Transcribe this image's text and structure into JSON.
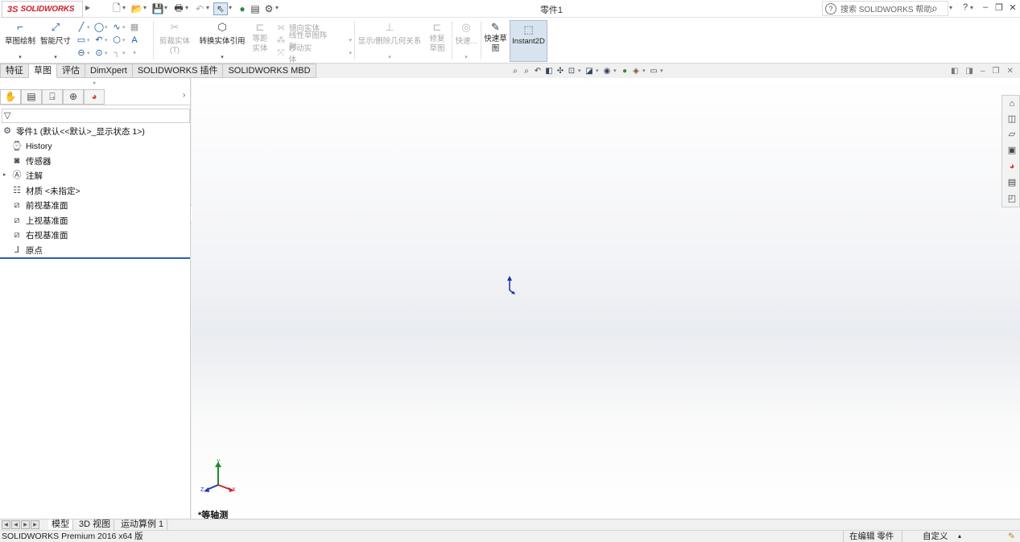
{
  "app": {
    "logo_ds": "3S",
    "logo_text": "SOLIDWORKS",
    "doc_title": "零件1",
    "search_placeholder": "搜索 SOLIDWORKS 帮助",
    "help_label": "?"
  },
  "command_manager": {
    "sketch": "草图绘制",
    "smart_dim": "智能尺寸",
    "trim": "剪裁实体(T)",
    "convert": "转换实体引用",
    "offset": "等距实体",
    "mirror": "镜向实体",
    "linear_pattern": "线性草图阵列",
    "move": "移动实体",
    "relations": "显示/删除几何关系",
    "repair": "修复草图",
    "quick_snaps": "快速...",
    "rapid_sketch": "快速草图",
    "instant2d": "Instant2D"
  },
  "tabs": [
    "特征",
    "草图",
    "评估",
    "DimXpert",
    "SOLIDWORKS 插件",
    "SOLIDWORKS MBD"
  ],
  "active_tab": "草图",
  "feature_tree": {
    "root": "零件1 (默认<<默认>_显示状态 1>)",
    "items": [
      {
        "label": "History",
        "icon": "history-icon"
      },
      {
        "label": "传感器",
        "icon": "sensor-icon"
      },
      {
        "label": "注解",
        "icon": "annotation-icon"
      },
      {
        "label": "材质 <未指定>",
        "icon": "material-icon"
      },
      {
        "label": "前视基准面",
        "icon": "plane-icon"
      },
      {
        "label": "上视基准面",
        "icon": "plane-icon"
      },
      {
        "label": "右视基准面",
        "icon": "plane-icon"
      },
      {
        "label": "原点",
        "icon": "origin-icon"
      }
    ]
  },
  "viewport": {
    "view_label": "*等轴测",
    "axis_x": "X",
    "axis_y": "Y",
    "axis_z": "Z"
  },
  "bottom_tabs": [
    "模型",
    "3D 视图",
    "运动算例 1"
  ],
  "status": {
    "product": "SOLIDWORKS Premium 2016 x64 版",
    "editing": "在编辑 零件",
    "units": "自定义"
  }
}
